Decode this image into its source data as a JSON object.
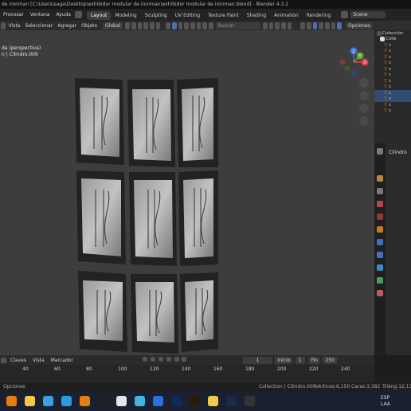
{
  "window": {
    "title": "de ironman [C:\\Users\\saga\\Desktop\\exhibidor modular de ironman\\exhibidor modular de ironman.blend] - Blender 4.3.2"
  },
  "menubar": {
    "items": [
      "Procesar",
      "Ventana",
      "Ayuda"
    ],
    "workspaces": [
      "Layout",
      "Modeling",
      "Sculpting",
      "UV Editing",
      "Texture Paint",
      "Shading",
      "Animation",
      "Rendering"
    ],
    "active_workspace": "Layout",
    "scene": "Scene"
  },
  "viewport_header": {
    "menus": [
      "Vista",
      "Seleccionar",
      "Agregar",
      "Objeto"
    ],
    "orientation": "Global",
    "search_placeholder": "Buscar",
    "options_label": "Opciones"
  },
  "viewport": {
    "view_name": "da (perspectiva)",
    "object_info": "n | Cilindro.009",
    "gizmo_axes": [
      "X",
      "Y",
      "Z"
    ],
    "accent_colors": {
      "x": "#e0424f",
      "y": "#6aa52f",
      "z": "#3f77d6"
    }
  },
  "outliner": {
    "root_label": "Colección",
    "collection_label": "Colle",
    "rows": [
      "c",
      "c",
      "c",
      "c",
      "c",
      "c",
      "c",
      "c",
      "c",
      "c",
      "c",
      "c"
    ],
    "selected_rows": [
      8,
      9
    ]
  },
  "properties": {
    "object_name": "Cilindro"
  },
  "timeline": {
    "menus": [
      "Claves",
      "Vista",
      "Marcador"
    ],
    "current_frame": "1",
    "start_label": "Inicio",
    "start_value": "1",
    "end_label": "Fin",
    "end_value": "250",
    "ticks": [
      "40",
      "60",
      "80",
      "100",
      "120",
      "140",
      "160",
      "180",
      "200",
      "220",
      "240"
    ]
  },
  "statusbar": {
    "left": "Opciones",
    "collection": "Collection | Cilindro.009",
    "vertices": "Vértices:6,150",
    "faces": "Caras:3,382",
    "triangles": "Triáng:12,134"
  },
  "taskbar": {
    "language": "ESP",
    "layout": "LAA",
    "icons": [
      "blender-icon",
      "file-explorer-icon",
      "edge-icon",
      "telegram-icon",
      "blender-app-icon",
      "capcut-icon",
      "media-icon",
      "box-icon",
      "dropbox-icon",
      "photoshop-icon",
      "illustrator-icon",
      "chrome-icon",
      "steam-icon",
      "app-icon-2"
    ]
  }
}
